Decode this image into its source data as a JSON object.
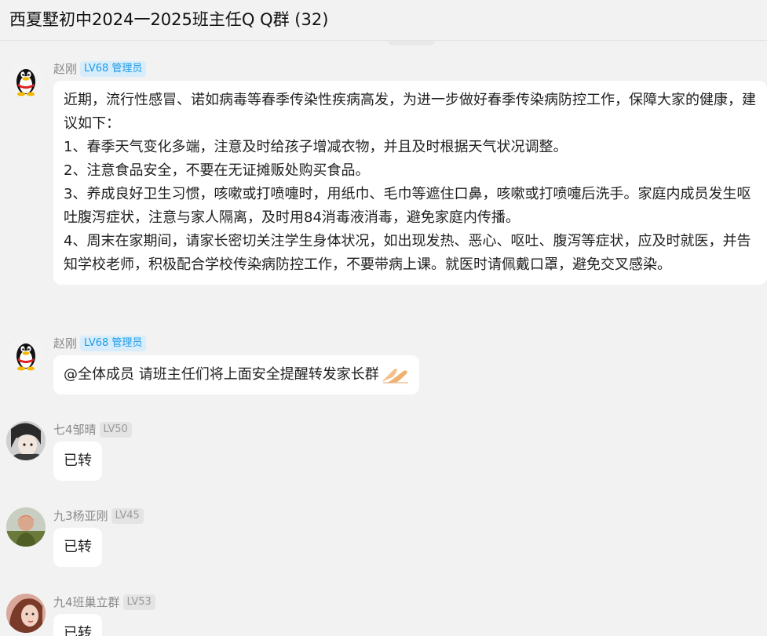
{
  "header": {
    "title": "西夏墅初中2024一2025班主任Q Q群 (32)"
  },
  "messages": [
    {
      "sender": "赵刚",
      "badge": "LV68 管理员",
      "avatar": "qq-penguin-icon",
      "paragraphs": [
        " 近期，流行性感冒、诺如病毒等春季传染性疾病高发，为进一步做好春季传染病防控工作，保障大家的健康，建议如下：",
        "1、春季天气变化多端，注意及时给孩子增减衣物，并且及时根据天气状况调整。",
        "2、注意食品安全，不要在无证摊贩处购买食品。",
        "3、养成良好卫生习惯，咳嗽或打喷嚏时，用纸巾、毛巾等遮住口鼻，咳嗽或打喷嚏后洗手。家庭内成员发生呕吐腹泻症状，注意与家人隔离，及时用84消毒液消毒，避免家庭内传播。",
        "4、周末在家期间，请家长密切关注学生身体状况，如出现发热、恶心、呕吐、腹泻等症状，应及时就医，并告知学校老师，积极配合学校传染病防控工作，不要带病上课。就医时请佩戴口罩，避免交叉感染。"
      ]
    },
    {
      "sender": "赵刚",
      "badge": "LV68 管理员",
      "avatar": "qq-penguin-icon",
      "text": "@全体成员 请班主任们将上面安全提醒转发家长群",
      "emoji": "pray-hands-icon"
    },
    {
      "sender": "七4邹晴",
      "badge": "LV50",
      "avatar": "anime-avatar",
      "text": "已转"
    },
    {
      "sender": "九3杨亚刚",
      "badge": "LV45",
      "avatar": "photo-avatar-green",
      "text": "已转"
    },
    {
      "sender": "九4班巢立群",
      "badge": "LV53",
      "avatar": "photo-avatar-pink",
      "text": "已转"
    }
  ],
  "colors": {
    "background": "#f2f2f2",
    "bubble": "#ffffff",
    "admin_badge_bg": "#d7edfb",
    "admin_badge_text": "#1e9be8",
    "level_badge_bg": "#e4e4e4"
  }
}
